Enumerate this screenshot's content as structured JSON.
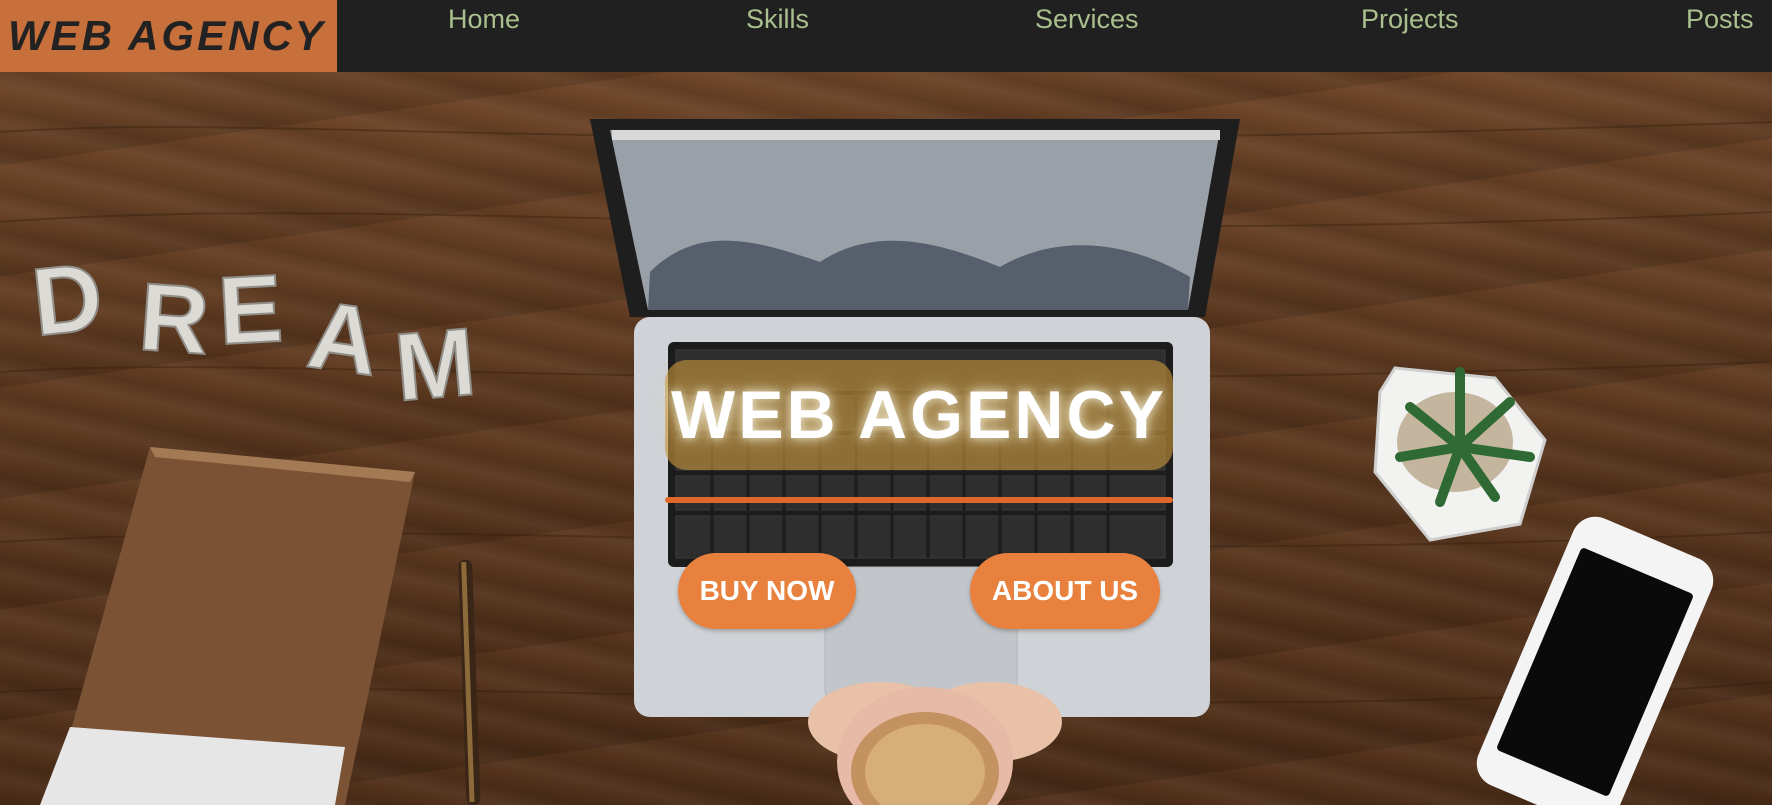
{
  "nav": {
    "brand": "WEB AGENCY",
    "links": [
      "Home",
      "Skills",
      "Services",
      "Projects",
      "Posts"
    ]
  },
  "hero": {
    "title": "WEB AGENCY",
    "buy_label": "BUY NOW",
    "about_label": "ABOUT US",
    "desk_letters": [
      "D",
      "R",
      "E",
      "A",
      "M"
    ]
  },
  "colors": {
    "nav_bg": "#202020",
    "brand_bg": "#c8703c",
    "nav_link": "#a9c08e",
    "button_bg": "#e8803e",
    "underline": "#e0662a"
  }
}
